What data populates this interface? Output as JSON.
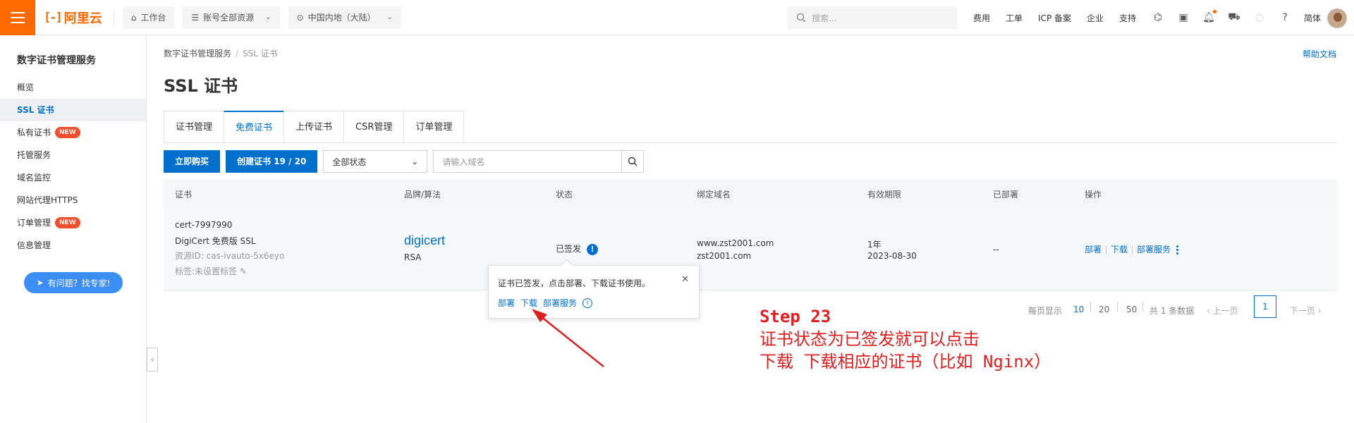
{
  "topbar": {
    "brand": "阿里云",
    "workbench": "工作台",
    "account_resources": "账号全部资源",
    "region": "中国内地（大陆）",
    "search_placeholder": "搜索...",
    "links": [
      "费用",
      "工单",
      "ICP 备案",
      "企业",
      "支持"
    ],
    "lang": "简体",
    "icons": [
      "terminal-icon",
      "cloud-shell-icon",
      "bell-icon",
      "cart-icon",
      "lightbulb-icon",
      "help-icon"
    ]
  },
  "sidebar": {
    "title": "数字证书管理服务",
    "items": [
      {
        "label": "概览"
      },
      {
        "label": "SSL 证书",
        "active": true
      },
      {
        "label": "私有证书",
        "badge": "NEW"
      },
      {
        "label": "托管服务"
      },
      {
        "label": "域名监控"
      },
      {
        "label": "网站代理HTTPS"
      },
      {
        "label": "订单管理",
        "badge": "NEW"
      },
      {
        "label": "信息管理"
      }
    ],
    "expert_button": "有问题？找专家!"
  },
  "breadcrumb": [
    "数字证书管理服务",
    "SSL 证书"
  ],
  "help_link": "帮助文档",
  "page_title": "SSL 证书",
  "tabs": [
    "证书管理",
    "免费证书",
    "上传证书",
    "CSR管理",
    "订单管理"
  ],
  "active_tab": "免费证书",
  "toolbar": {
    "buy_now": "立即购买",
    "create_cert": "创建证书 19 / 20",
    "status_select": "全部状态",
    "domain_placeholder": "请输入域名"
  },
  "table": {
    "headers": [
      "证书",
      "品牌/算法",
      "状态",
      "绑定域名",
      "有效期限",
      "已部署",
      "操作"
    ],
    "row": {
      "cert_id": "cert-7997990",
      "cert_name": "DigiCert 免费版 SSL",
      "resource_id": "资源ID: cas-ivauto-5x6eyo",
      "tags": "标签:未设置标签",
      "brand": "digicert",
      "algorithm": "RSA",
      "status": "已签发",
      "domains": [
        "www.zst2001.com",
        "zst2001.com"
      ],
      "validity": "1年",
      "expiry": "2023-08-30",
      "deployed": "--",
      "ops": [
        "部署",
        "下载",
        "部署服务"
      ]
    }
  },
  "popover": {
    "message": "证书已签发，点击部署、下载证书使用。",
    "links": [
      "部署",
      "下载",
      "部署服务"
    ]
  },
  "pagination": {
    "per_page_label": "每页显示",
    "sizes": [
      "10",
      "20",
      "50"
    ],
    "selected_size": "10",
    "total": "共 1 条数据",
    "prev": "上一页",
    "current": "1",
    "next": "下一页"
  },
  "annotation": {
    "step": "Step 23",
    "line1": "证书状态为已签发就可以点击",
    "line2": "下载 下载相应的证书（比如 Nginx）"
  },
  "colors": {
    "brand_orange": "#ff6a00",
    "primary_blue": "#0070cc",
    "annotation_red": "#e02020"
  }
}
